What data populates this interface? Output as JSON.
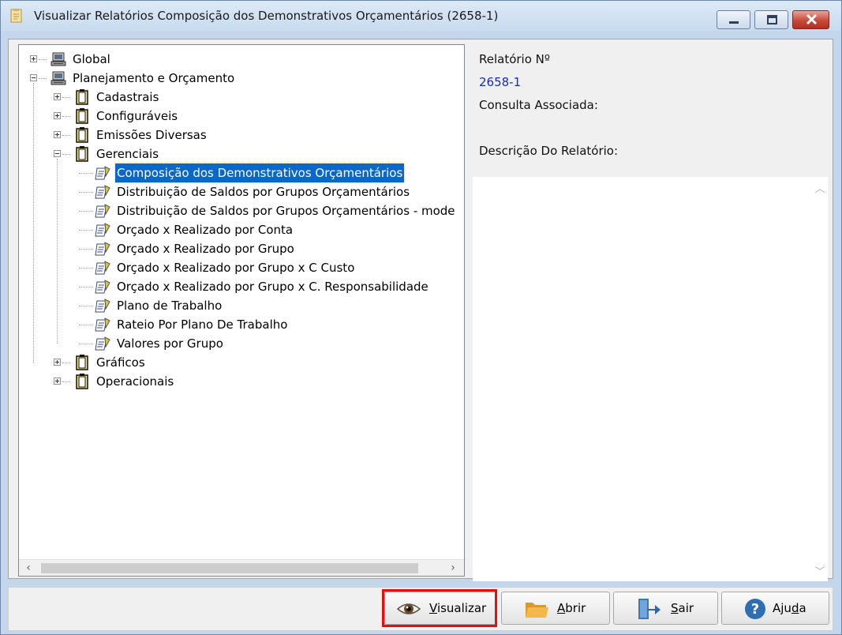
{
  "window": {
    "title": "Visualizar Relatórios Composição dos Demonstrativos Orçamentários (2658-1)",
    "minimize_label": "",
    "maximize_label": "",
    "close_label": ""
  },
  "tree": {
    "nodes": [
      {
        "label": "Global",
        "icon": "computer-icon",
        "level": 0,
        "expander": "plus"
      },
      {
        "label": "Planejamento e Orçamento",
        "icon": "computer-icon",
        "level": 0,
        "expander": "minus"
      },
      {
        "label": "Cadastrais",
        "icon": "clipboard-icon",
        "level": 1,
        "expander": "plus"
      },
      {
        "label": "Configuráveis",
        "icon": "clipboard-icon",
        "level": 1,
        "expander": "plus"
      },
      {
        "label": "Emissões Diversas",
        "icon": "clipboard-icon",
        "level": 1,
        "expander": "plus"
      },
      {
        "label": "Gerenciais",
        "icon": "clipboard-icon",
        "level": 1,
        "expander": "minus"
      },
      {
        "label": "Composição dos Demonstrativos Orçamentários",
        "icon": "report-icon",
        "level": 2,
        "selected": true
      },
      {
        "label": "Distribuição de Saldos por Grupos Orçamentários",
        "icon": "report-icon",
        "level": 2
      },
      {
        "label": "Distribuição de Saldos por Grupos Orçamentários - mode",
        "icon": "report-icon",
        "level": 2
      },
      {
        "label": "Orçado x Realizado por Conta",
        "icon": "report-icon",
        "level": 2
      },
      {
        "label": "Orçado x Realizado por Grupo",
        "icon": "report-icon",
        "level": 2
      },
      {
        "label": "Orçado x Realizado por Grupo x C Custo",
        "icon": "report-icon",
        "level": 2
      },
      {
        "label": "Orçado x Realizado por Grupo x C. Responsabilidade",
        "icon": "report-icon",
        "level": 2
      },
      {
        "label": "Plano de Trabalho",
        "icon": "report-icon",
        "level": 2
      },
      {
        "label": "Rateio Por Plano De Trabalho",
        "icon": "report-icon",
        "level": 2
      },
      {
        "label": "Valores por Grupo",
        "icon": "report-icon",
        "level": 2
      },
      {
        "label": "Gráficos",
        "icon": "clipboard-icon",
        "level": 1,
        "expander": "plus"
      },
      {
        "label": "Operacionais",
        "icon": "clipboard-icon",
        "level": 1,
        "expander": "plus"
      }
    ],
    "scroll_left": "‹",
    "scroll_right": "›"
  },
  "info": {
    "report_number_label": "Relatório Nº",
    "report_number_value": "2658-1",
    "query_label": "Consulta Associada:",
    "description_label": "Descrição Do Relatório:",
    "scroll_up": "︿",
    "scroll_down": "﹀"
  },
  "buttons": {
    "view": {
      "accel": "V",
      "rest": "isualizar",
      "icon": "eye-icon"
    },
    "open": {
      "accel": "A",
      "rest": "brir",
      "icon": "folder-icon"
    },
    "exit": {
      "accel": "S",
      "rest": "air",
      "icon": "exit-door-icon"
    },
    "help": {
      "pre": "Aju",
      "accel": "d",
      "rest": "a",
      "icon": "help-icon"
    }
  },
  "colors": {
    "selection": "#0a67cc",
    "info_value": "#1a2fa6",
    "highlight_border": "#e21010"
  }
}
